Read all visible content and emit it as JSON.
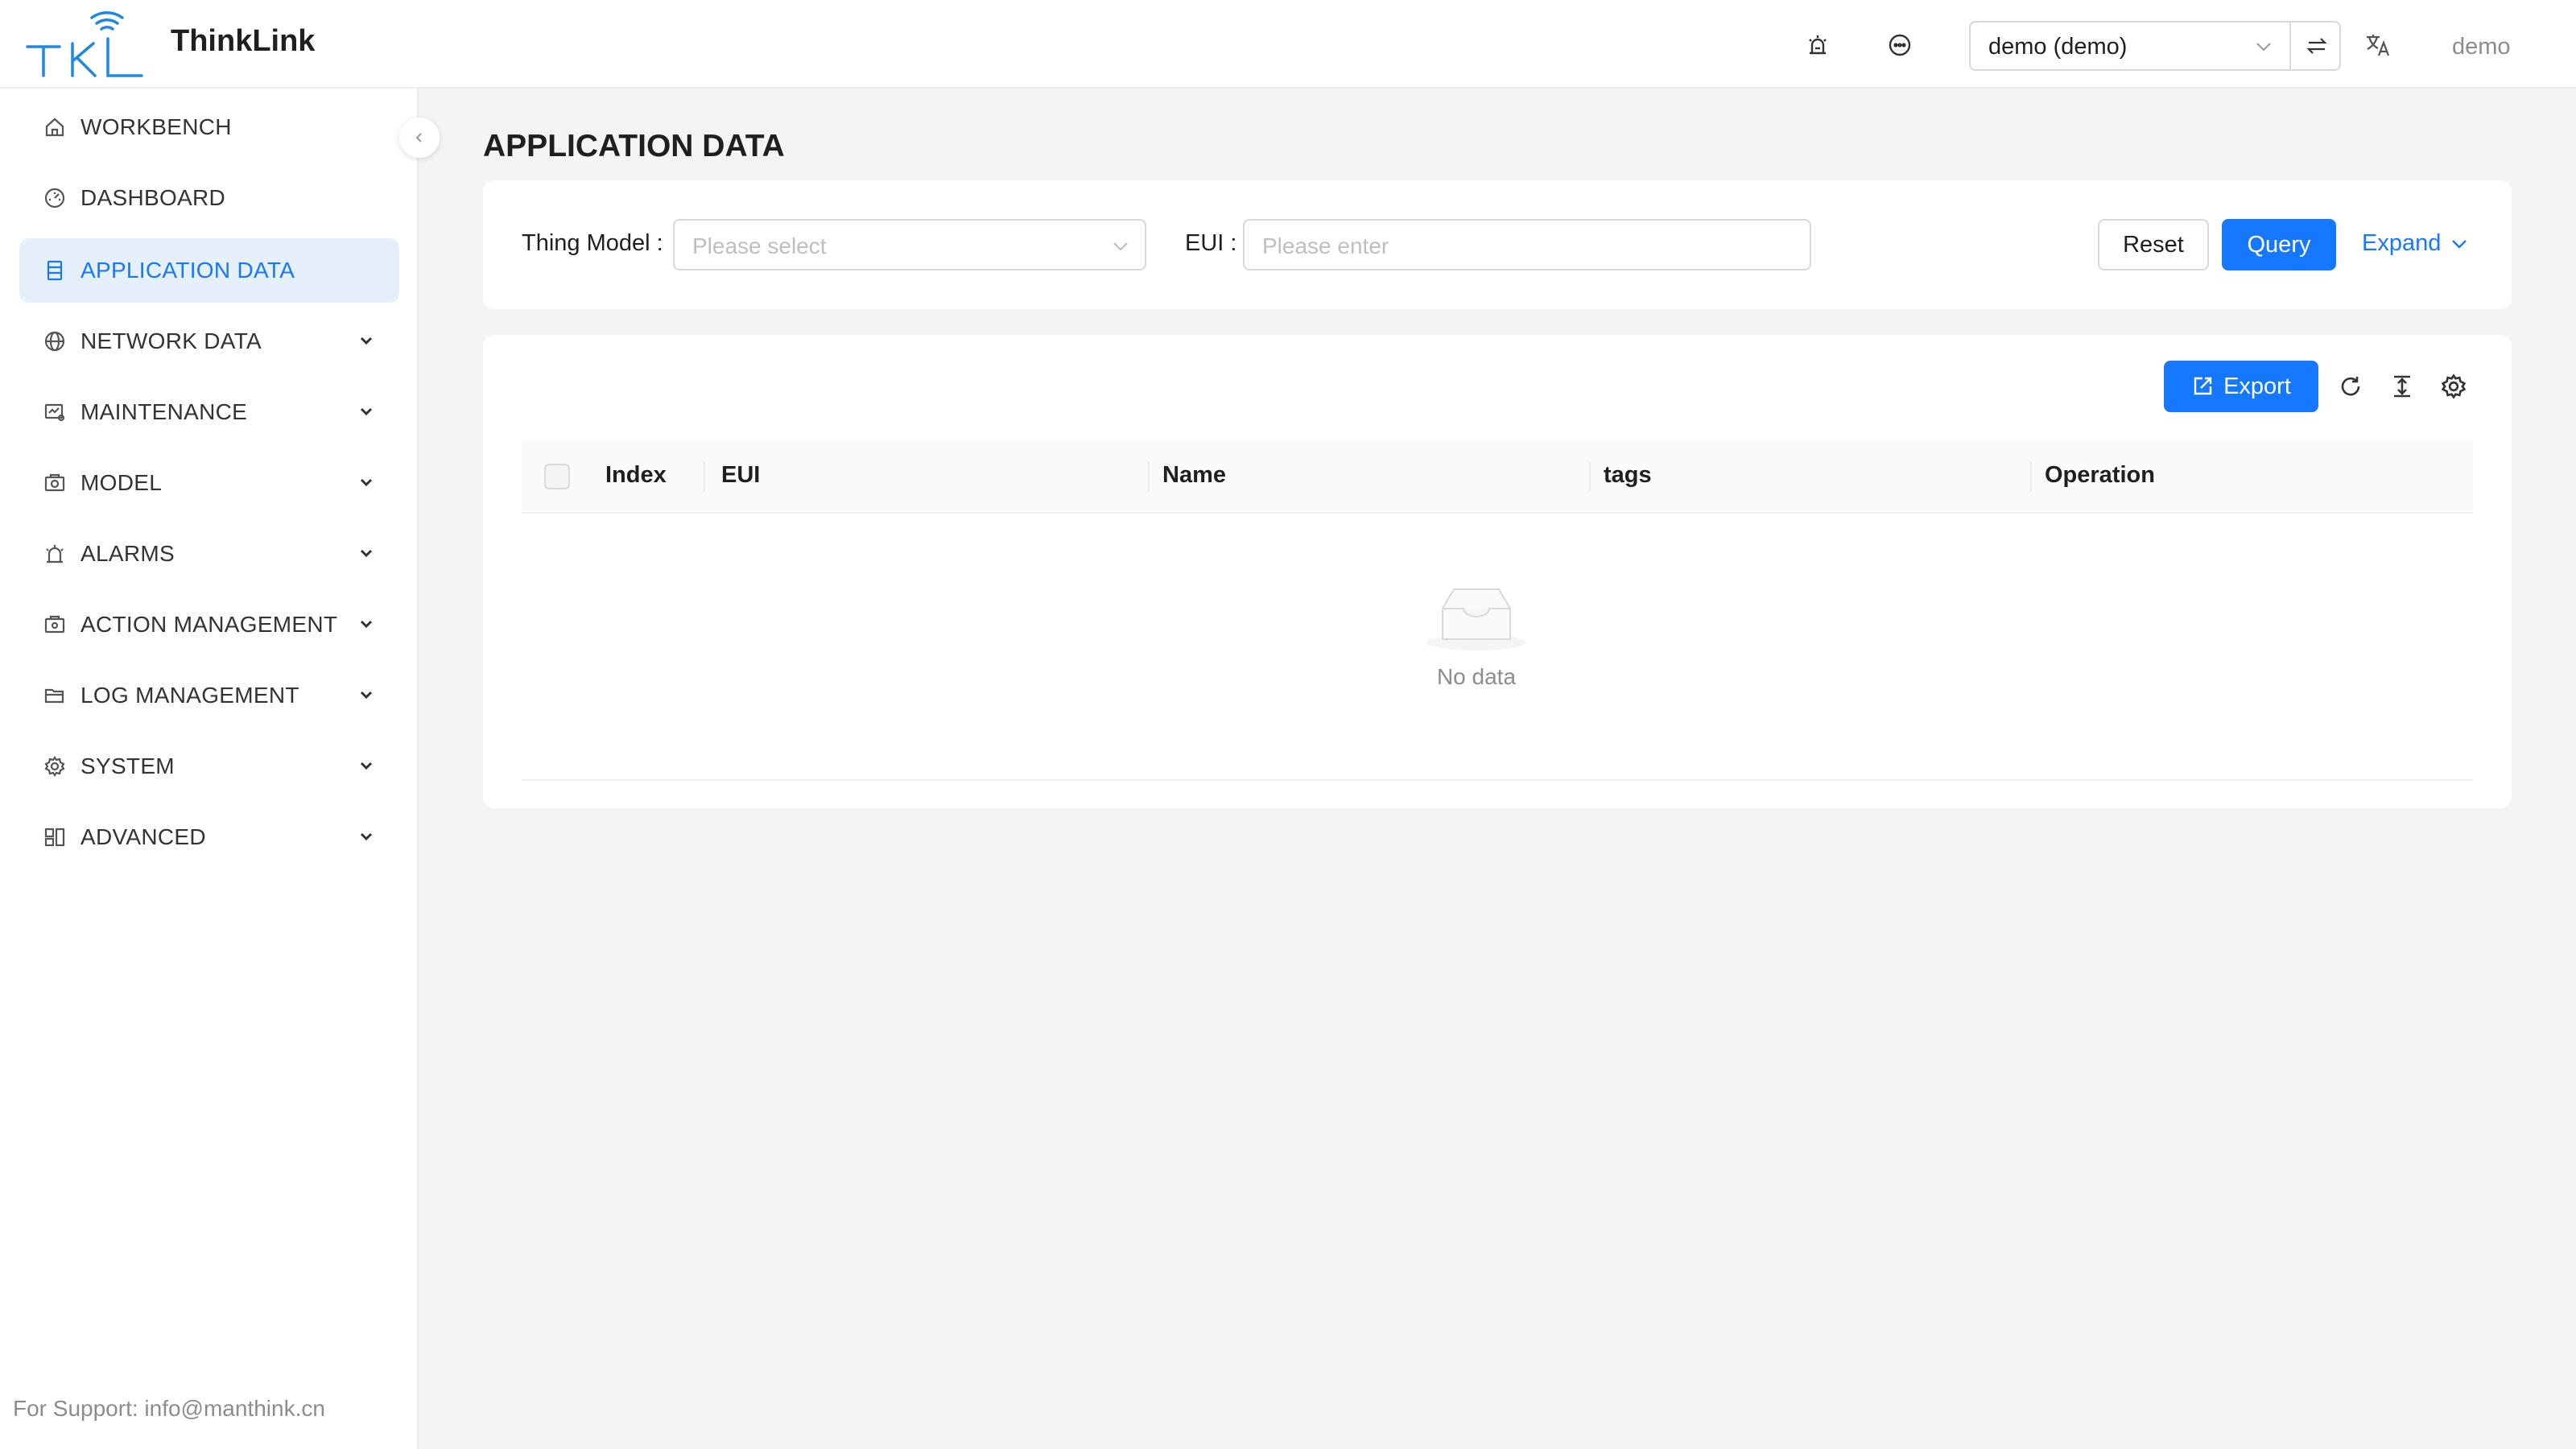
{
  "app": {
    "brand": "ThinkLink",
    "logo_text": "TKL"
  },
  "header": {
    "org_select_value": "demo (demo)",
    "user_name": "demo",
    "icons": [
      "alarm-icon",
      "message-icon",
      "swap-icon",
      "translate-icon"
    ]
  },
  "sidebar": {
    "items": [
      {
        "label": "WORKBENCH",
        "icon": "home-icon",
        "expandable": false,
        "active": false
      },
      {
        "label": "DASHBOARD",
        "icon": "dashboard-icon",
        "expandable": false,
        "active": false
      },
      {
        "label": "APPLICATION DATA",
        "icon": "database-icon",
        "expandable": false,
        "active": true
      },
      {
        "label": "NETWORK DATA",
        "icon": "globe-icon",
        "expandable": true,
        "active": false
      },
      {
        "label": "MAINTENANCE",
        "icon": "maintenance-icon",
        "expandable": true,
        "active": false
      },
      {
        "label": "MODEL",
        "icon": "model-icon",
        "expandable": true,
        "active": false
      },
      {
        "label": "ALARMS",
        "icon": "alarm-icon",
        "expandable": true,
        "active": false
      },
      {
        "label": "ACTION MANAGEMENT",
        "icon": "action-icon",
        "expandable": true,
        "active": false
      },
      {
        "label": "LOG MANAGEMENT",
        "icon": "folder-icon",
        "expandable": true,
        "active": false
      },
      {
        "label": "SYSTEM",
        "icon": "gear-icon",
        "expandable": true,
        "active": false
      },
      {
        "label": "ADVANCED",
        "icon": "advanced-icon",
        "expandable": true,
        "active": false
      }
    ],
    "support_text": "For Support: info@manthink.cn"
  },
  "main": {
    "title": "APPLICATION DATA",
    "filters": {
      "thing_model_label": "Thing Model",
      "thing_model_placeholder": "Please select",
      "eui_label": "EUI",
      "eui_placeholder": "Please enter",
      "reset_label": "Reset",
      "query_label": "Query",
      "expand_label": "Expand"
    },
    "table": {
      "export_label": "Export",
      "columns": [
        "Index",
        "EUI",
        "Name",
        "tags",
        "Operation"
      ],
      "empty_text": "No data"
    }
  },
  "colors": {
    "primary": "#1677ff",
    "active_bg": "#e6f0fc",
    "background": "#f3f4f6"
  }
}
